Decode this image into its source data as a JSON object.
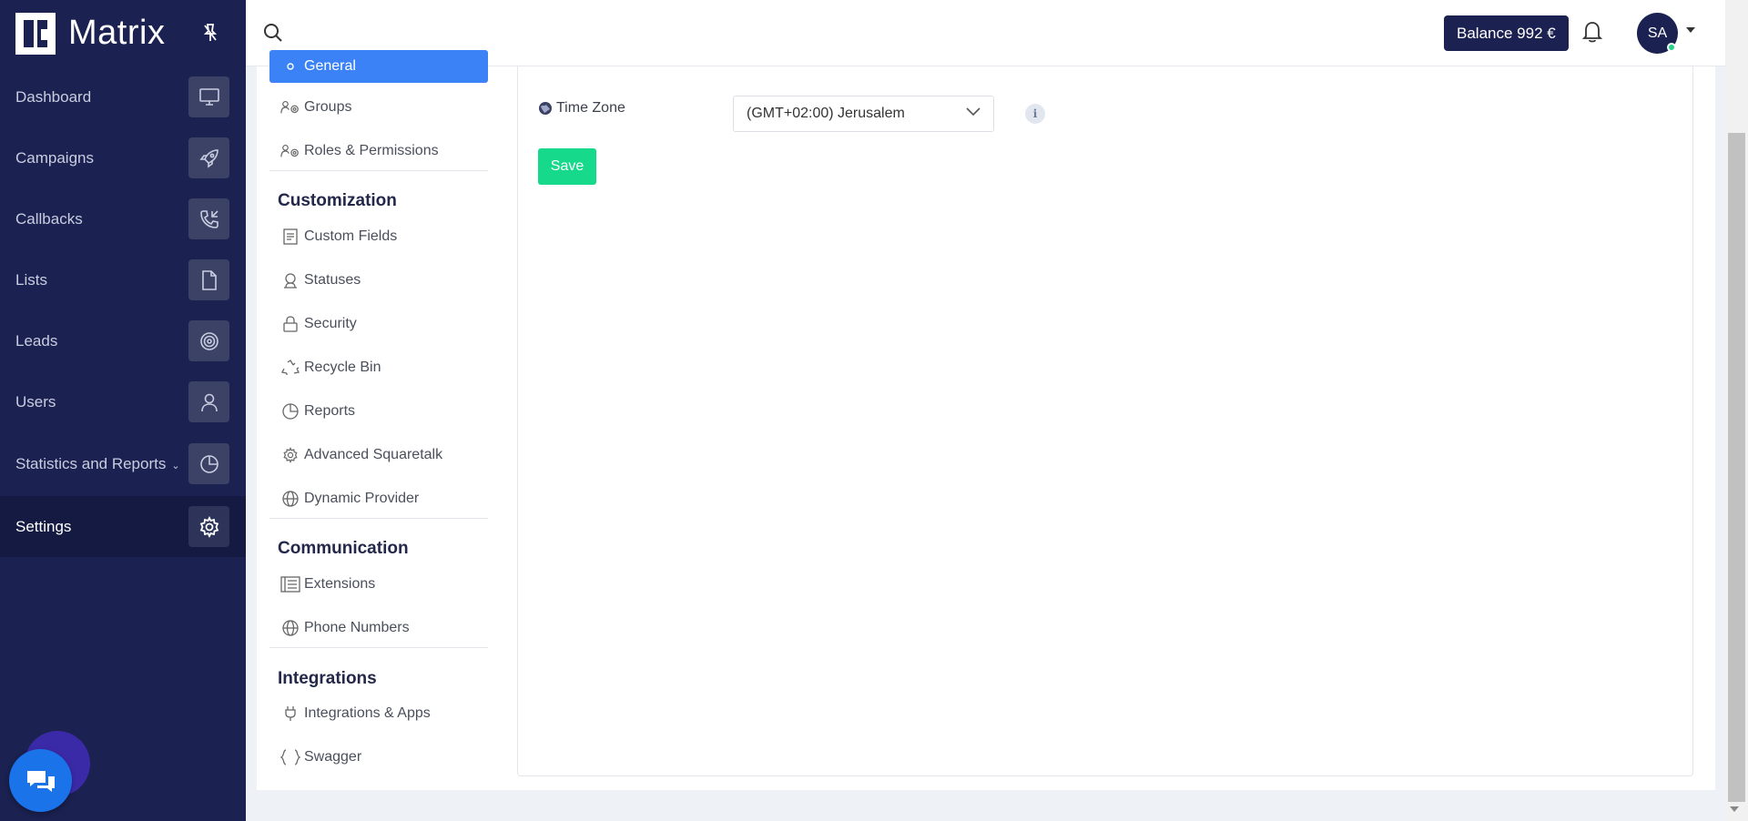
{
  "brand": {
    "name": "Matrix"
  },
  "sidebar": {
    "items": [
      {
        "label": "Dashboard",
        "icon": "monitor-icon"
      },
      {
        "label": "Campaigns",
        "icon": "rocket-icon"
      },
      {
        "label": "Callbacks",
        "icon": "phone-callback-icon"
      },
      {
        "label": "Lists",
        "icon": "file-icon"
      },
      {
        "label": "Leads",
        "icon": "target-icon"
      },
      {
        "label": "Users",
        "icon": "user-icon"
      },
      {
        "label": "Statistics and Reports",
        "icon": "pie-chart-icon"
      },
      {
        "label": "Settings",
        "icon": "gear-icon",
        "active": true
      }
    ]
  },
  "topbar": {
    "balance": "Balance 992 €",
    "avatar_initials": "SA"
  },
  "settings_menu": {
    "general": "General",
    "groups": "Groups",
    "roles": "Roles & Permissions",
    "customization_title": "Customization",
    "custom_fields": "Custom Fields",
    "statuses": "Statuses",
    "security": "Security",
    "recycle_bin": "Recycle Bin",
    "reports": "Reports",
    "advanced_squaretalk": "Advanced Squaretalk",
    "dynamic_provider": "Dynamic Provider",
    "communication_title": "Communication",
    "extensions": "Extensions",
    "phone_numbers": "Phone Numbers",
    "integrations_title": "Integrations",
    "integrations_apps": "Integrations & Apps",
    "swagger": "Swagger"
  },
  "form": {
    "timezone_label": "Time Zone",
    "timezone_value": "(GMT+02:00) Jerusalem",
    "info": "i",
    "save_label": "Save"
  },
  "colors": {
    "sidebar_bg": "#1b2150",
    "accent_blue": "#3b82f6",
    "save_green": "#16d98b"
  }
}
